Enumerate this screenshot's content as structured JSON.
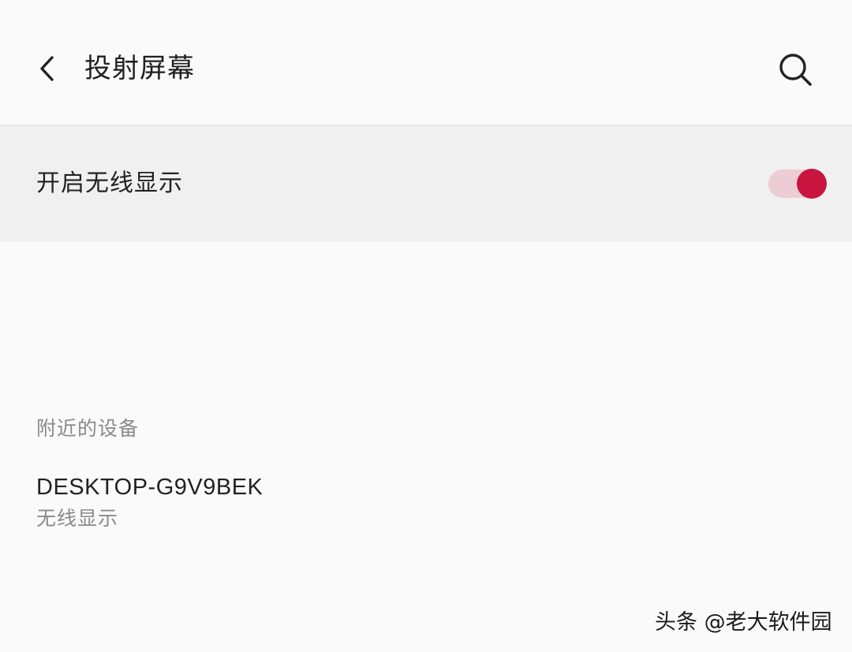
{
  "header": {
    "title": "投射屏幕",
    "back_icon": "chevron-left-icon",
    "search_icon": "search-icon"
  },
  "wireless_display": {
    "label": "开启无线显示",
    "enabled": true,
    "accent_color": "#c8143f",
    "track_color": "#ecccd5"
  },
  "nearby": {
    "section_title": "附近的设备",
    "devices": [
      {
        "name": "DESKTOP-G9V9BEK",
        "type": "无线显示"
      }
    ]
  },
  "watermark": {
    "text": "头条 @老大软件园"
  }
}
